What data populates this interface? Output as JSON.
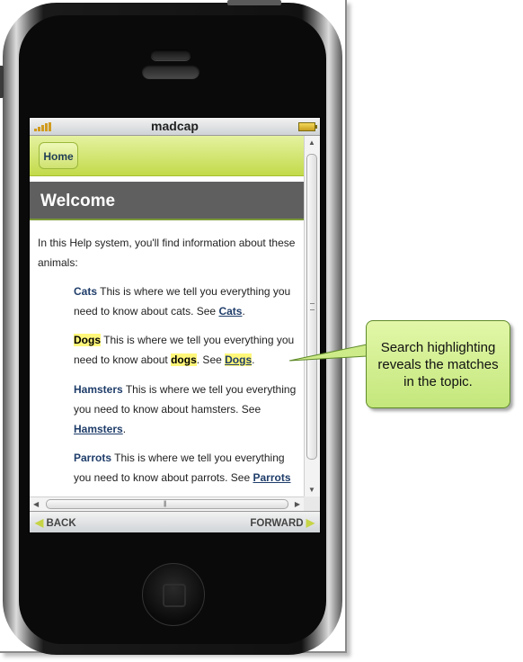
{
  "statusbar": {
    "title": "madcap"
  },
  "nav": {
    "home_label": "Home"
  },
  "topic": {
    "heading": "Welcome",
    "intro": "In this Help system, you'll find information about these animals:",
    "entries": [
      {
        "term": "Cats",
        "text": " This is where we tell you everything you need to know about cats. See ",
        "link": "Cats",
        "end": "."
      },
      {
        "term": "Dogs",
        "text1": " This is where we tell you everything you need to know about ",
        "match": "dogs",
        "text2": ". See ",
        "link": "Dogs",
        "end": "."
      },
      {
        "term": "Hamsters",
        "text": " This is where we tell you everything you need to know about hamsters. See ",
        "link": "Hamsters",
        "end": "."
      },
      {
        "term": "Parrots",
        "text": " This is where we tell you everything you need to know about parrots. See ",
        "link": "Parrots",
        "end": ""
      }
    ]
  },
  "bottom": {
    "back_label": "BACK",
    "forward_label": "FORWARD"
  },
  "callout": {
    "text": "Search highlighting reveals the matches in the topic."
  },
  "colors": {
    "highlight": "#fff77a",
    "accent": "#c2da4a",
    "callout": "#c4e77c"
  }
}
